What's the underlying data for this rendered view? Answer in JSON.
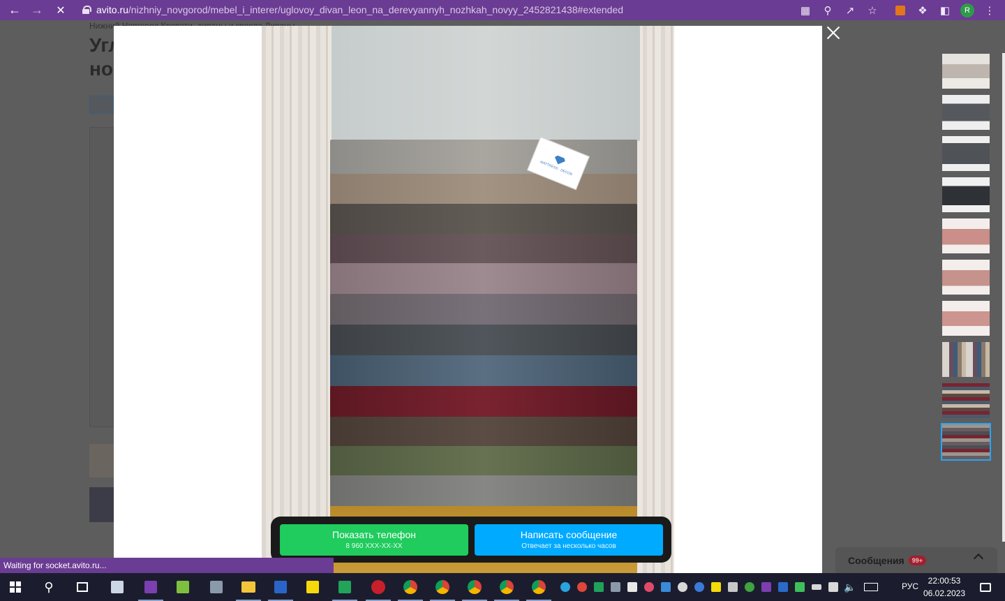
{
  "browser": {
    "url_host": "avito.ru",
    "url_path": "/nizhniy_novgorod/mebel_i_interer/uglovoy_divan_leon_na_derevyannyh_nozhkah_novyy_2452821438#extended",
    "profile_initial": "R"
  },
  "background_page": {
    "breadcrumb": "Нижний Новгород   Кровати, диваны и кресла  Диваны",
    "title_line1": "Угл",
    "title_line2": "но"
  },
  "gallery": {
    "thumbnail_count": 10,
    "active_index": 9,
    "watermark": "Avito"
  },
  "contact": {
    "phone_label": "Показать телефон",
    "phone_sub": "8 960 XXX-XX-XX",
    "message_label": "Написать сообщение",
    "message_sub": "Отвечает за несколько часов"
  },
  "messages_widget": {
    "label": "Сообщения",
    "badge": "99+"
  },
  "status_bar": {
    "text": "Waiting for socket.avito.ru..."
  },
  "taskbar": {
    "language": "РУС",
    "time": "22:00:53",
    "date": "06.02.2023"
  },
  "colors": {
    "browser_purple": "#6b3c93",
    "phone_green": "#1fcc5d",
    "message_blue": "#00aaff"
  }
}
